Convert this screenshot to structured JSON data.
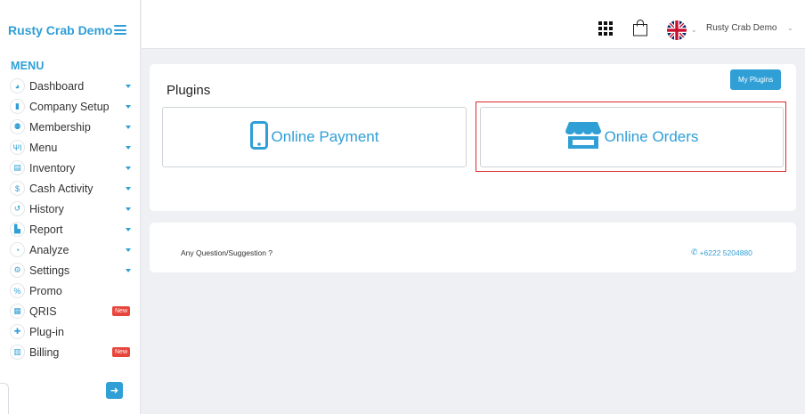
{
  "sidebar": {
    "brand": "Rusty Crab Demo",
    "menu_heading": "MENU",
    "items": [
      {
        "label": "Dashboard",
        "icon": "dashboard-icon",
        "glyph": "◕",
        "caret": true
      },
      {
        "label": "Company Setup",
        "icon": "building-icon",
        "glyph": "▮",
        "caret": true
      },
      {
        "label": "Membership",
        "icon": "users-icon",
        "glyph": "⚉",
        "caret": true
      },
      {
        "label": "Menu",
        "icon": "utensils-icon",
        "glyph": "ΨΙ",
        "caret": true
      },
      {
        "label": "Inventory",
        "icon": "inventory-icon",
        "glyph": "▤",
        "caret": true
      },
      {
        "label": "Cash Activity",
        "icon": "dollar-icon",
        "glyph": "$",
        "caret": true
      },
      {
        "label": "History",
        "icon": "history-icon",
        "glyph": "↺",
        "caret": true
      },
      {
        "label": "Report",
        "icon": "report-icon",
        "glyph": "▙",
        "caret": true
      },
      {
        "label": "Analyze",
        "icon": "pie-chart-icon",
        "glyph": "◔",
        "caret": true
      },
      {
        "label": "Settings",
        "icon": "gear-icon",
        "glyph": "⚙",
        "caret": true
      },
      {
        "label": "Promo",
        "icon": "percent-icon",
        "glyph": "%",
        "caret": false
      },
      {
        "label": "QRIS",
        "icon": "qr-icon",
        "glyph": "▦",
        "caret": false,
        "badge": "New"
      },
      {
        "label": "Plug-in",
        "icon": "plugin-icon",
        "glyph": "✚",
        "caret": false
      },
      {
        "label": "Billing",
        "icon": "billing-icon",
        "glyph": "▥",
        "caret": false,
        "badge": "New"
      }
    ]
  },
  "topbar": {
    "user_name": "Rusty Crab Demo"
  },
  "plugins": {
    "title": "Plugins",
    "my_plugins_label": "My Plugins",
    "online_payment_label": "Online Payment",
    "online_orders_label": "Online Orders"
  },
  "contact": {
    "question": "Any Question/Suggestion ?",
    "phone": "+6222 5204880"
  },
  "colors": {
    "accent": "#2f9fd6",
    "badge": "#e8453c",
    "highlight": "#d92b2b"
  }
}
